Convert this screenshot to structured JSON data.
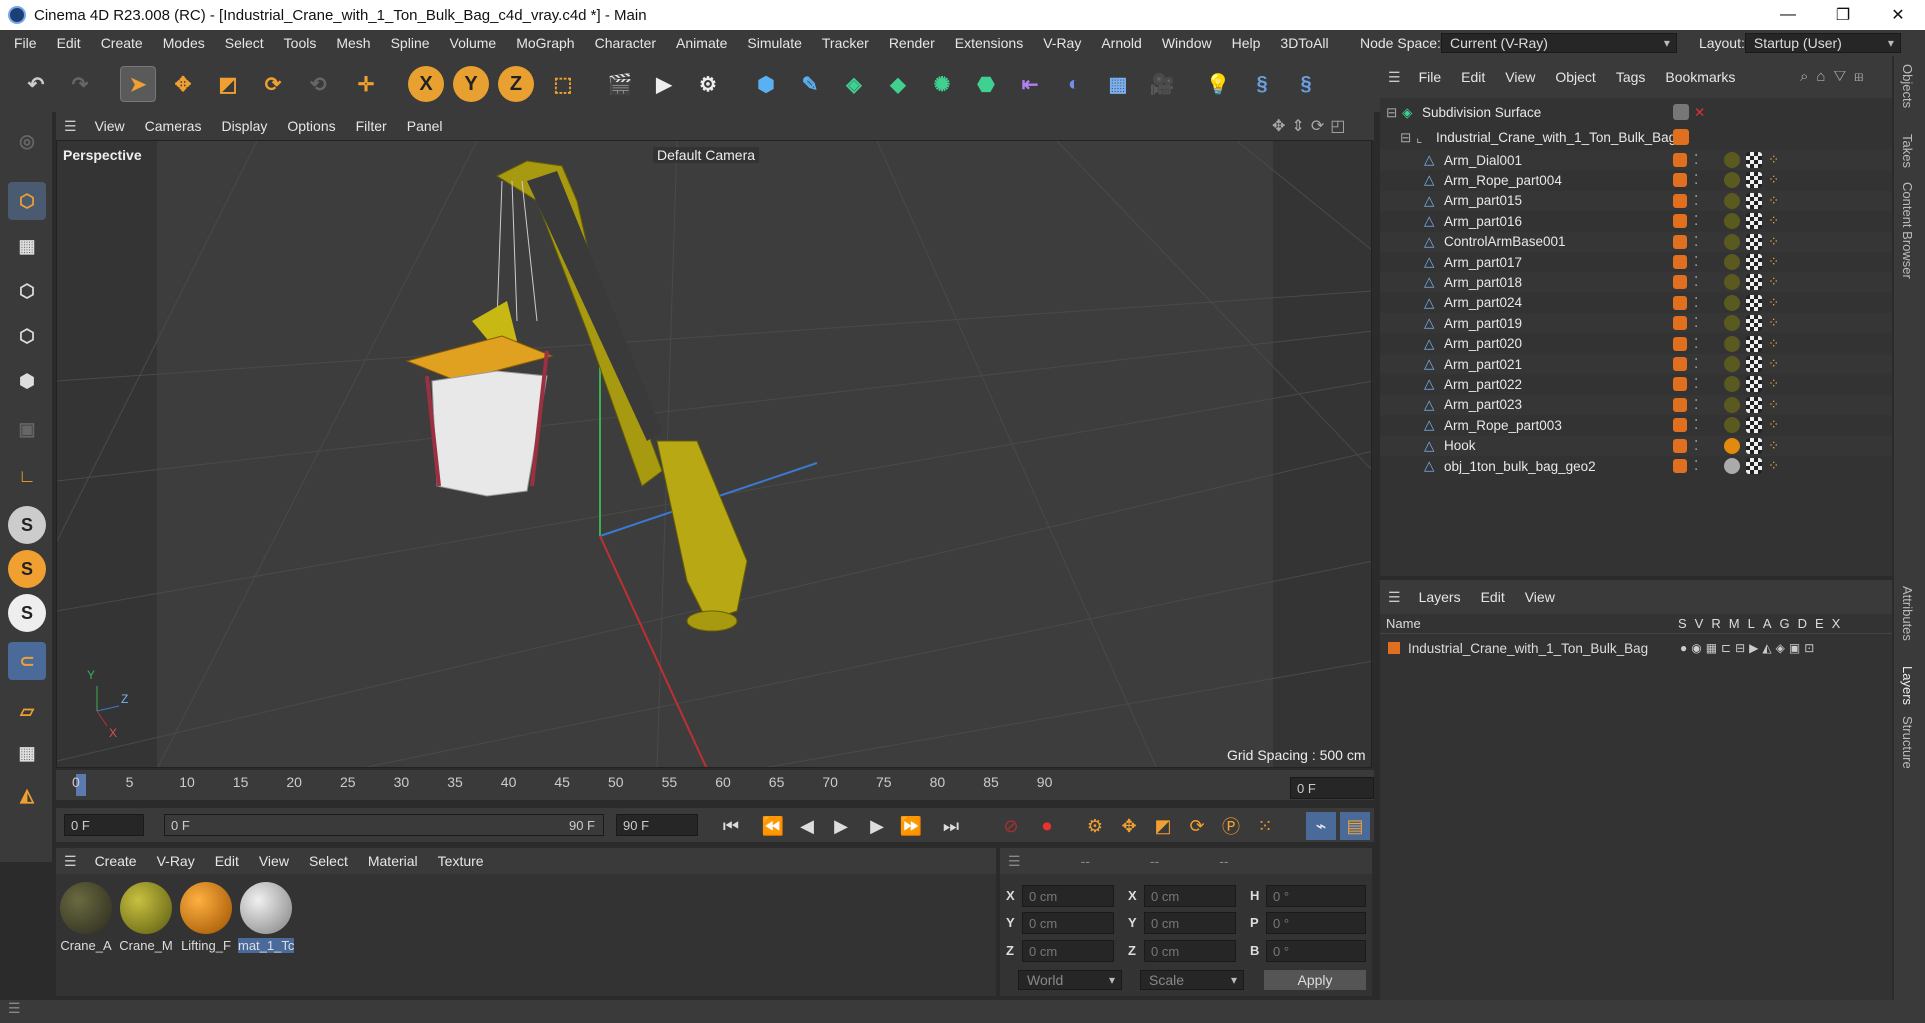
{
  "window": {
    "title": "Cinema 4D R23.008 (RC) - [Industrial_Crane_with_1_Ton_Bulk_Bag_c4d_vray.c4d *] - Main",
    "minimize": "—",
    "maximize": "❐",
    "close": "✕"
  },
  "menu": {
    "items": [
      "File",
      "Edit",
      "Create",
      "Modes",
      "Select",
      "Tools",
      "Mesh",
      "Spline",
      "Volume",
      "MoGraph",
      "Character",
      "Animate",
      "Simulate",
      "Tracker",
      "Render",
      "Extensions",
      "V-Ray",
      "Arnold",
      "Window",
      "Help",
      "3DToAll"
    ],
    "node_space_label": "Node Space:",
    "node_space_value": "Current (V-Ray)",
    "layout_label": "Layout:",
    "layout_value": "Startup (User)"
  },
  "toolbar": {
    "x": "X",
    "y": "Y",
    "z": "Z"
  },
  "viewport": {
    "menu": [
      "View",
      "Cameras",
      "Display",
      "Options",
      "Filter",
      "Panel"
    ],
    "name": "Perspective",
    "camera": "Default Camera",
    "grid_spacing": "Grid Spacing : 500 cm"
  },
  "timeline": {
    "ticks": [
      "0",
      "5",
      "10",
      "15",
      "20",
      "25",
      "30",
      "35",
      "40",
      "45",
      "50",
      "55",
      "60",
      "65",
      "70",
      "75",
      "80",
      "85",
      "90"
    ],
    "current_frame": "0 F",
    "start": "0 F",
    "range_start": "0 F",
    "range_end": "90 F",
    "end": "90 F"
  },
  "materials": {
    "menu": [
      "Create",
      "V-Ray",
      "Edit",
      "View",
      "Select",
      "Material",
      "Texture"
    ],
    "items": [
      {
        "name": "Crane_A",
        "color": "#3a3a2a"
      },
      {
        "name": "Crane_M",
        "color": "#8a8a20"
      },
      {
        "name": "Lifting_F",
        "color": "#e08a10"
      },
      {
        "name": "mat_1_Tc",
        "color": "#c8c8c8"
      }
    ]
  },
  "coordinates": {
    "header": [
      "--",
      "--",
      "--"
    ],
    "rows": [
      {
        "a": "X",
        "av": "0 cm",
        "b": "X",
        "bv": "0 cm",
        "c": "H",
        "cv": "0 °"
      },
      {
        "a": "Y",
        "av": "0 cm",
        "b": "Y",
        "bv": "0 cm",
        "c": "P",
        "cv": "0 °"
      },
      {
        "a": "Z",
        "av": "0 cm",
        "b": "Z",
        "bv": "0 cm",
        "c": "B",
        "cv": "0 °"
      }
    ],
    "world": "World",
    "scale": "Scale",
    "apply": "Apply"
  },
  "objects": {
    "menu": [
      "File",
      "Edit",
      "View",
      "Object",
      "Tags",
      "Bookmarks"
    ],
    "root": "Subdivision Surface",
    "group": "Industrial_Crane_with_1_Ton_Bulk_Bag",
    "items": [
      "Arm_Dial001",
      "Arm_Rope_part004",
      "Arm_part015",
      "Arm_part016",
      "ControlArmBase001",
      "Arm_part017",
      "Arm_part018",
      "Arm_part024",
      "Arm_part019",
      "Arm_part020",
      "Arm_part021",
      "Arm_part022",
      "Arm_part023",
      "Arm_Rope_part003",
      "Hook",
      "obj_1ton_bulk_bag_geo2"
    ]
  },
  "layers": {
    "menu": [
      "Layers",
      "Edit",
      "View"
    ],
    "name_col": "Name",
    "cols": [
      "S",
      "V",
      "R",
      "M",
      "L",
      "A",
      "G",
      "D",
      "E",
      "X"
    ],
    "items": [
      "Industrial_Crane_with_1_Ton_Bulk_Bag"
    ]
  },
  "side_tabs": [
    "Objects",
    "Takes",
    "Content Browser",
    "Attributes",
    "Layers",
    "Structure"
  ],
  "colors": {
    "accent": "#e07020",
    "yellow": "#c8b400",
    "selection": "#4a6a9a"
  }
}
